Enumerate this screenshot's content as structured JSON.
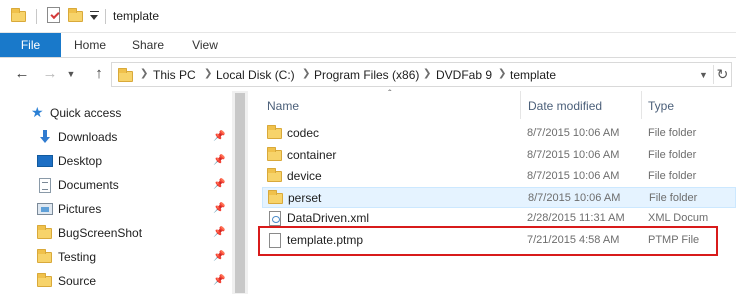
{
  "window": {
    "title": "template"
  },
  "ribbon": {
    "tabs": [
      {
        "label": "File"
      },
      {
        "label": "Home"
      },
      {
        "label": "Share"
      },
      {
        "label": "View"
      }
    ],
    "accent": "#1979ca"
  },
  "address": {
    "crumbs": [
      "This PC",
      "Local Disk (C:)",
      "Program Files (x86)",
      "DVDFab 9",
      "template"
    ]
  },
  "nav": {
    "quick_access_label": "Quick access",
    "items": [
      {
        "label": "Downloads",
        "icon": "download-arrow-icon",
        "pinned": true
      },
      {
        "label": "Desktop",
        "icon": "desktop-icon",
        "pinned": true
      },
      {
        "label": "Documents",
        "icon": "documents-icon",
        "pinned": true
      },
      {
        "label": "Pictures",
        "icon": "pictures-icon",
        "pinned": true
      },
      {
        "label": "BugScreenShot",
        "icon": "folder-icon",
        "pinned": true
      },
      {
        "label": "Testing",
        "icon": "folder-icon",
        "pinned": true
      },
      {
        "label": "Source",
        "icon": "folder-icon",
        "pinned": true
      }
    ]
  },
  "files": {
    "columns": {
      "name": "Name",
      "date": "Date modified",
      "type": "Type"
    },
    "rows": [
      {
        "name": "codec",
        "date": "8/7/2015 10:06 AM",
        "type": "File folder",
        "icon": "folder-icon"
      },
      {
        "name": "container",
        "date": "8/7/2015 10:06 AM",
        "type": "File folder",
        "icon": "folder-icon"
      },
      {
        "name": "device",
        "date": "8/7/2015 10:06 AM",
        "type": "File folder",
        "icon": "folder-icon"
      },
      {
        "name": "perset",
        "date": "8/7/2015 10:06 AM",
        "type": "File folder",
        "icon": "folder-icon",
        "selected": true
      },
      {
        "name": "DataDriven.xml",
        "date": "2/28/2015 11:31 AM",
        "type": "XML Docum",
        "icon": "xml-file-icon"
      },
      {
        "name": "template.ptmp",
        "date": "7/21/2015 4:58 AM",
        "type": "PTMP File",
        "icon": "file-icon",
        "highlighted": true
      }
    ]
  },
  "colors": {
    "highlight_border": "#d81b1b",
    "selection_bg": "#e5f3ff",
    "folder_yellow": "#f7d36a"
  }
}
